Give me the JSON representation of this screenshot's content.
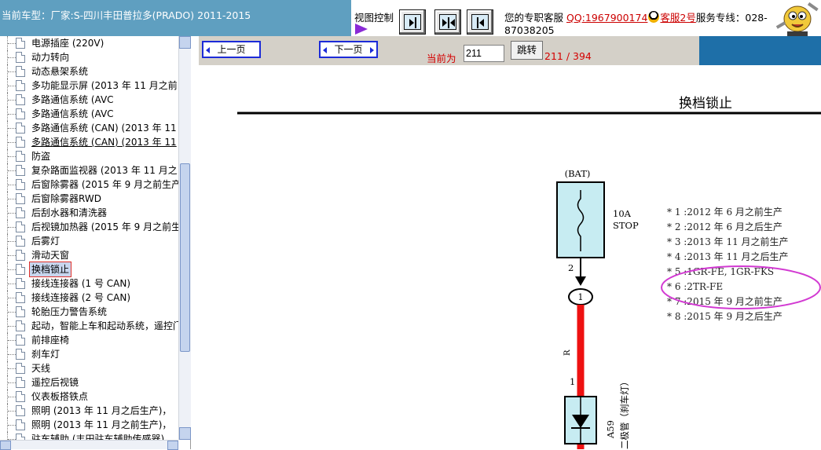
{
  "header": {
    "title": "当前车型：厂家:S-四川丰田普拉多(PRADO) 2011-2015",
    "view_control_label": "视图控制",
    "view_buttons": [
      "page-right",
      "page-fit",
      "page-left"
    ],
    "contact_prefix": "您的专职客服",
    "qq_link": "QQ:1967900174",
    "service2_link": "客服2号",
    "hotline_label": "服务专线：028-",
    "hotline_number": "87038205"
  },
  "sidebar": {
    "items": [
      {
        "label": "电源插座 (220V)",
        "underlined": false,
        "selected": false
      },
      {
        "label": "动力转向",
        "underlined": false,
        "selected": false
      },
      {
        "label": "动态悬架系统",
        "underlined": false,
        "selected": false
      },
      {
        "label": "多功能显示屏 (2013 年 11 月之前",
        "underlined": false,
        "selected": false
      },
      {
        "label": "多路通信系统 (AVC",
        "underlined": false,
        "selected": false
      },
      {
        "label": "多路通信系统 (AVC",
        "underlined": false,
        "selected": false
      },
      {
        "label": "多路通信系统 (CAN) (2013 年 11",
        "underlined": false,
        "selected": false
      },
      {
        "label": "多路通信系统 (CAN) (2013 年 11",
        "underlined": true,
        "selected": false
      },
      {
        "label": "防盗",
        "underlined": false,
        "selected": false
      },
      {
        "label": "复杂路面监视器 (2013 年 11 月之",
        "underlined": false,
        "selected": false
      },
      {
        "label": "后窗除雾器 (2015 年 9 月之前生产",
        "underlined": false,
        "selected": false
      },
      {
        "label": "后窗除雾器RWD",
        "underlined": false,
        "selected": false
      },
      {
        "label": "后刮水器和清洗器",
        "underlined": false,
        "selected": false
      },
      {
        "label": "后视镜加热器 (2015 年 9 月之前生",
        "underlined": false,
        "selected": false
      },
      {
        "label": "后雾灯",
        "underlined": false,
        "selected": false
      },
      {
        "label": "滑动天窗",
        "underlined": false,
        "selected": false
      },
      {
        "label": "换档锁止",
        "underlined": false,
        "selected": true
      },
      {
        "label": "接线连接器 (1 号 CAN)",
        "underlined": false,
        "selected": false
      },
      {
        "label": "接线连接器 (2 号 CAN)",
        "underlined": false,
        "selected": false
      },
      {
        "label": "轮胎压力警告系统",
        "underlined": false,
        "selected": false
      },
      {
        "label": "起动，智能上车和起动系统，遥控门锁",
        "underlined": false,
        "selected": false
      },
      {
        "label": "前排座椅",
        "underlined": false,
        "selected": false
      },
      {
        "label": "刹车灯",
        "underlined": false,
        "selected": false
      },
      {
        "label": "天线",
        "underlined": false,
        "selected": false
      },
      {
        "label": "遥控后视镜",
        "underlined": false,
        "selected": false
      },
      {
        "label": "仪表板搭铁点",
        "underlined": false,
        "selected": false
      },
      {
        "label": "照明 (2013 年 11 月之后生产)，",
        "underlined": false,
        "selected": false
      },
      {
        "label": "照明 (2013 年 11 月之前生产)，",
        "underlined": false,
        "selected": false
      },
      {
        "label": "驻车辅助 (丰田驻车辅助传感器)",
        "underlined": false,
        "selected": false
      }
    ]
  },
  "nav": {
    "prev_label": "上一页",
    "next_label": "下一页",
    "current_label": "当前为",
    "page_value": "211",
    "jump_label": "跳转",
    "page_count": "211 / 394"
  },
  "diagram": {
    "title": "换档锁止",
    "bat_label": "(BAT)",
    "fuse_amp": "10A",
    "fuse_name": "STOP",
    "pin_fuse_out": "2",
    "connector_num": "1",
    "wire_color": "R",
    "pin_diode_in": "1",
    "diode_code": "A59",
    "diode_name": "二极管（刹车灯）",
    "notes": [
      "* 1 :2012 年 6 月之前生产",
      "* 2 :2012 年 6 月之后生产",
      "* 3 :2013 年 11 月之前生产",
      "* 4 :2013 年 11 月之后生产",
      "* 5 :1GR-FE, 1GR-FKS",
      "* 6 :2TR-FE",
      "* 7 :2015 年 9 月之前生产",
      "* 8 :2015 年 9 月之后生产"
    ],
    "highlight_color": "#d23ad2",
    "wire_hex": "#ee1111",
    "fuse_fill": "#c7ecf2"
  }
}
